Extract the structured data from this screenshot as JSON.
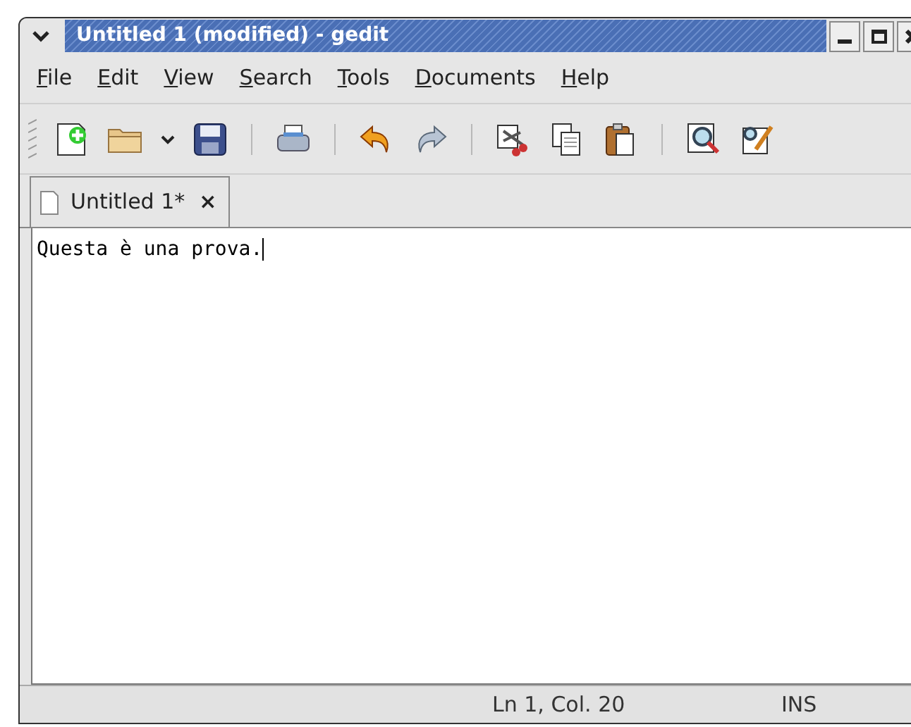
{
  "window": {
    "title": "Untitled 1 (modified) - gedit"
  },
  "menu": [
    "File",
    "Edit",
    "View",
    "Search",
    "Tools",
    "Documents",
    "Help"
  ],
  "toolbar": [
    {
      "kind": "new"
    },
    {
      "kind": "open"
    },
    {
      "kind": "dropdown"
    },
    {
      "kind": "save"
    },
    {
      "kind": "separator"
    },
    {
      "kind": "print"
    },
    {
      "kind": "separator"
    },
    {
      "kind": "undo"
    },
    {
      "kind": "redo"
    },
    {
      "kind": "separator"
    },
    {
      "kind": "cut"
    },
    {
      "kind": "copy"
    },
    {
      "kind": "paste"
    },
    {
      "kind": "separator"
    },
    {
      "kind": "find"
    },
    {
      "kind": "replace"
    }
  ],
  "tabs": [
    {
      "label": "Untitled 1*",
      "selected": true,
      "close": "×"
    }
  ],
  "editor": {
    "text": "Questa è una prova."
  },
  "status_bar": {
    "position": "Ln 1, Col. 20",
    "mode": "INS"
  }
}
